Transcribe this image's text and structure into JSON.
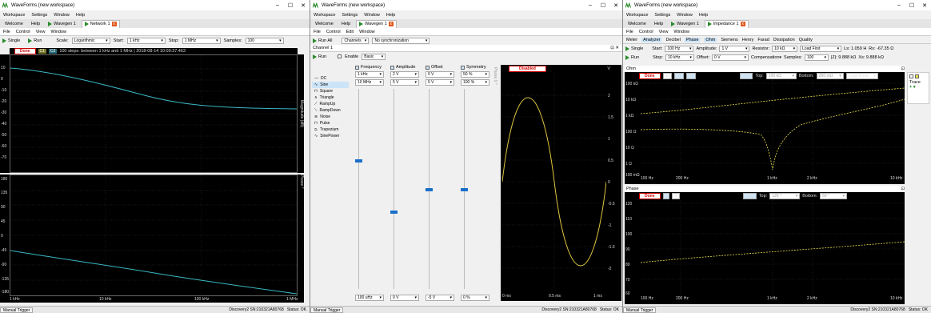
{
  "network": {
    "titlebar": {
      "app": "WaveForms",
      "workspace": "(new workspace)"
    },
    "menu": [
      "Workspace",
      "Settings",
      "Window",
      "Help"
    ],
    "tabs": [
      "Welcome",
      "Help",
      "Wavegen 1",
      "Network 1"
    ],
    "submenu": [
      "File",
      "Control",
      "View",
      "Window"
    ],
    "toolbar": {
      "single": "Single",
      "run": "Run",
      "scale_label": "Scale:",
      "scale": "Logarithmic",
      "start_label": "Start:",
      "start": "1 kHz",
      "stop_label": "Stop:",
      "stop": "1 MHz",
      "samples_label": "Samples:",
      "samples": "100"
    },
    "plot_header": {
      "state": "Done",
      "c1": "C1",
      "c2": "C2",
      "info": "100 steps: between 1 kHz and 1 MHz | 2018-08-14 10:09:37.463"
    },
    "mag_yticks": [
      "10",
      "0",
      "-10",
      "-20",
      "-30",
      "-40",
      "-50",
      "-60",
      "-70",
      "-80",
      "-90"
    ],
    "mag_label": "Magnitude (dB)",
    "phase_yticks": [
      "180",
      "135",
      "90",
      "45",
      "0",
      "-45",
      "-90",
      "-135",
      "-180"
    ],
    "phase_label": "Phase °",
    "xticks": [
      "1 kHz",
      "10 kHz",
      "100 kHz",
      "1 MHz"
    ],
    "status": {
      "trigger": "Manual Trigger",
      "device": "Discovery2 SN:210321A80768",
      "status": "Status: OK"
    }
  },
  "wavegen": {
    "titlebar": {
      "app": "WaveForms",
      "workspace": "(new workspace)"
    },
    "menu": [
      "Workspace",
      "Settings",
      "Window",
      "Help"
    ],
    "tabs": [
      "Welcome",
      "Help",
      "Wavegen 1"
    ],
    "submenu": [
      "File",
      "Control",
      "Edit",
      "Window"
    ],
    "toolbar": {
      "channels": "Channels",
      "sync": "No synchronization"
    },
    "channel_title": "Channel 1",
    "run": "Run",
    "enable": "Enable",
    "mode": "Basic",
    "waveforms": [
      "DC",
      "Sine",
      "Square",
      "Triangle",
      "RampUp",
      "RampDown",
      "Noise",
      "Pulse",
      "Trapezium",
      "SinePower"
    ],
    "params": [
      {
        "name": "Frequency",
        "value": "1 kHz",
        "max": "10 MHz",
        "min": "100 uHz"
      },
      {
        "name": "Amplitude",
        "value": "2 V",
        "max": "5 V",
        "min": "0 V"
      },
      {
        "name": "Offset",
        "value": "0 V",
        "max": "5 V",
        "min": "-5 V"
      },
      {
        "name": "Symmetry",
        "value": "50 %",
        "max": "100 %",
        "min": "0 %"
      }
    ],
    "phase_label": "Phase 0 °",
    "preview_state": "Disabled",
    "preview_unit": "V",
    "preview_yticks": [
      "2",
      "1.5",
      "1",
      "0.5",
      "0",
      "-0.5",
      "-1",
      "-1.5",
      "-2"
    ],
    "preview_xticks": [
      "0 ms",
      "0.5 ms",
      "1 ms"
    ],
    "status": {
      "trigger": "Manual Trigger",
      "device": "Discovery2 SN:210321A80768",
      "status": "Status: OK"
    }
  },
  "impedance": {
    "titlebar": {
      "app": "WaveForms",
      "workspace": "(new workspace)"
    },
    "menu": [
      "Workspace",
      "Settings",
      "Window",
      "Help"
    ],
    "tabs": [
      "Welcome",
      "Help",
      "Wavegen 1",
      "Impedance 1"
    ],
    "submenu": [
      "File",
      "Control",
      "View",
      "Window"
    ],
    "modes": [
      "Meter",
      "Analyzer",
      "Decibel",
      "Phase",
      "Ohm",
      "Siemens",
      "Henry",
      "Farad",
      "Dissipation",
      "Quality"
    ],
    "row1": {
      "single": "Single",
      "start_label": "Start:",
      "start": "100 Hz",
      "amp_label": "Amplitude:",
      "amp": "1 V",
      "res_label": "Resistor:",
      "res": "10 kΩ",
      "load": "Load First",
      "ls": "Ls: 1.059 H",
      "rs": "Rs: -67.35 Ω"
    },
    "row2": {
      "run": "Run",
      "stop_label": "Stop:",
      "stop": "10 kHz",
      "off_label": "Offset:",
      "off": "0 V",
      "comp": "Compensation",
      "samples_label": "Samples:",
      "samples": "100",
      "z": "|Z|: 9.888 kΩ",
      "xs": "Xs: 9.888 kΩ"
    },
    "ohm_title": "Ohm",
    "ohm_header": {
      "state": "Done",
      "z": "|Z|",
      "rs": "Rs",
      "xs": "Xs",
      "auto": "Auto",
      "top_label": "Top:",
      "top": "100 kΩ",
      "bottom_label": "Bottom:",
      "bottom": "200 mΩ",
      "scale": "Logarithmic"
    },
    "ohm_yticks": [
      "100 kΩ",
      "10 kΩ",
      "1 kΩ",
      "100 Ω",
      "10 Ω",
      "1 Ω",
      "100 mΩ"
    ],
    "phase_title": "Phase",
    "phase_header": {
      "state": "Done",
      "theta": "θ",
      "auto": "Auto",
      "top_label": "Top:",
      "top": "120 °",
      "bottom_label": "Bottom:",
      "bottom": "60 °"
    },
    "phase_yticks": [
      "120",
      "110",
      "100",
      "90",
      "80",
      "70",
      "60"
    ],
    "xticks": [
      "100 Hz",
      "200 Hz",
      "1 kHz",
      "2 kHz",
      "10 kHz"
    ],
    "trace_label": "Trace",
    "status": {
      "trigger": "Manual Trigger",
      "device": "Discovery2 SN:210321A80768",
      "status": "Status: OK"
    },
    "colors": {
      "trace": "#e8e04a",
      "plot_bg": "#000000",
      "done": "#cc0000"
    }
  },
  "colors": {
    "net_trace": "#3ab7c4",
    "wave_trace": "#e0c640",
    "accent": "#1a6fc9"
  }
}
